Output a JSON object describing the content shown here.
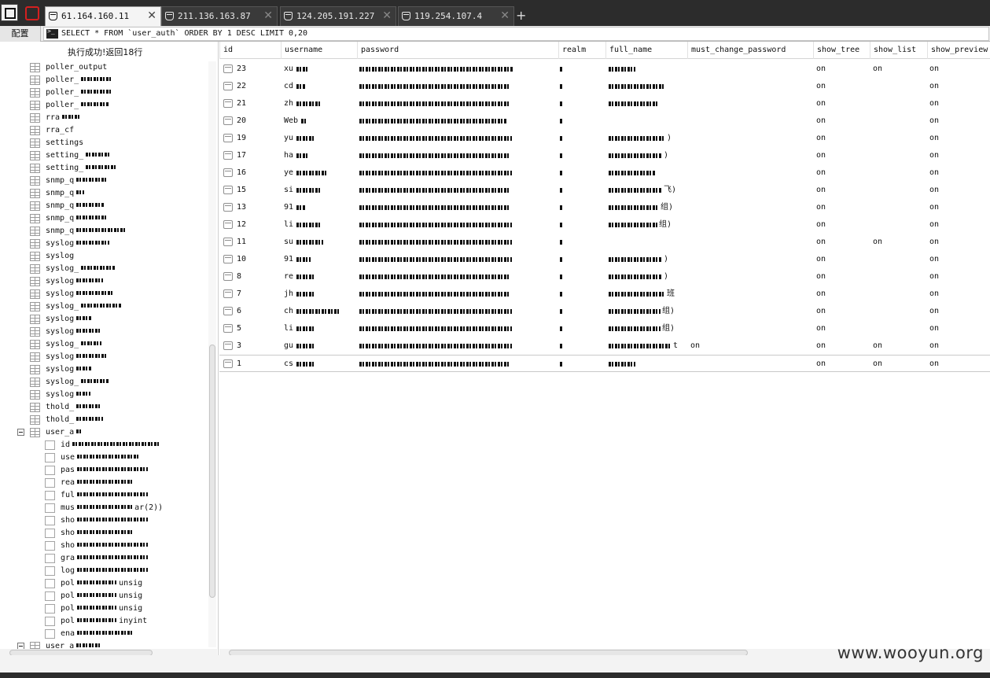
{
  "tabs": [
    {
      "label": "61.164.160.11",
      "active": true
    },
    {
      "label": "211.136.163.87",
      "active": false
    },
    {
      "label": "124.205.191.227",
      "active": false
    },
    {
      "label": "119.254.107.4",
      "active": false
    }
  ],
  "toolbar": {
    "config_label": "配置",
    "sql": "SELECT * FROM `user_auth` ORDER BY 1 DESC LIMIT 0,20"
  },
  "left": {
    "status": "执行成功!返回18行",
    "tables": [
      "poller_output",
      "poller_",
      "poller_",
      "poller_",
      "rra",
      "rra_cf",
      "settings",
      "setting_",
      "setting_",
      "snmp_q",
      "snmp_q",
      "snmp_q",
      "snmp_q",
      "snmp_q",
      "syslog",
      "syslog",
      "syslog_",
      "syslog",
      "syslog",
      "syslog_",
      "syslog",
      "syslog",
      "syslog_",
      "syslog",
      "syslog",
      "syslog_",
      "syslog",
      "thold_",
      "thold_"
    ],
    "expanded_table": "user_a",
    "columns": [
      "id",
      "use",
      "pas",
      "rea",
      "ful",
      "mus",
      "sho",
      "sho",
      "sho",
      "gra",
      "log",
      "pol",
      "pol",
      "pol",
      "pol",
      "ena"
    ],
    "column_tails": {
      "mus": "ar(2))",
      "pol1": "unsig",
      "pol2": "unsig",
      "pol3": "unsig",
      "pol4": "inyint"
    },
    "next_table": "user_a"
  },
  "grid": {
    "headers": [
      "id",
      "username",
      "password",
      "realm",
      "full_name",
      "must_change_password",
      "show_tree",
      "show_list",
      "show_preview"
    ],
    "rows": [
      {
        "id": "23",
        "username": "xu",
        "show_tree": "on",
        "show_list": "on",
        "show_preview": "on",
        "must_change": ""
      },
      {
        "id": "22",
        "username": "cd",
        "show_tree": "on",
        "show_list": "",
        "show_preview": "on",
        "must_change": ""
      },
      {
        "id": "21",
        "username": "zh",
        "show_tree": "on",
        "show_list": "",
        "show_preview": "on",
        "must_change": ""
      },
      {
        "id": "20",
        "username": "Web",
        "show_tree": "on",
        "show_list": "",
        "show_preview": "on",
        "must_change": ""
      },
      {
        "id": "19",
        "username": "yu",
        "show_tree": "on",
        "show_list": "",
        "show_preview": "on",
        "must_change": ""
      },
      {
        "id": "17",
        "username": "ha",
        "show_tree": "on",
        "show_list": "",
        "show_preview": "on",
        "must_change": ""
      },
      {
        "id": "16",
        "username": "ye",
        "show_tree": "on",
        "show_list": "",
        "show_preview": "on",
        "must_change": ""
      },
      {
        "id": "15",
        "username": "si",
        "show_tree": "on",
        "show_list": "",
        "show_preview": "on",
        "must_change": ""
      },
      {
        "id": "13",
        "username": "91",
        "show_tree": "on",
        "show_list": "",
        "show_preview": "on",
        "must_change": ""
      },
      {
        "id": "12",
        "username": "li",
        "show_tree": "on",
        "show_list": "",
        "show_preview": "on",
        "must_change": ""
      },
      {
        "id": "11",
        "username": "su",
        "show_tree": "on",
        "show_list": "on",
        "show_preview": "on",
        "must_change": ""
      },
      {
        "id": "10",
        "username": "91",
        "show_tree": "on",
        "show_list": "",
        "show_preview": "on",
        "must_change": ""
      },
      {
        "id": "8",
        "username": "re",
        "show_tree": "on",
        "show_list": "",
        "show_preview": "on",
        "must_change": ""
      },
      {
        "id": "7",
        "username": "jh",
        "show_tree": "on",
        "show_list": "",
        "show_preview": "on",
        "must_change": ""
      },
      {
        "id": "6",
        "username": "ch",
        "show_tree": "on",
        "show_list": "",
        "show_preview": "on",
        "must_change": ""
      },
      {
        "id": "5",
        "username": "li",
        "show_tree": "on",
        "show_list": "",
        "show_preview": "on",
        "must_change": ""
      },
      {
        "id": "3",
        "username": "gu",
        "show_tree": "on",
        "show_list": "on",
        "show_preview": "on",
        "must_change": "on"
      },
      {
        "id": "1",
        "username": "cs",
        "show_tree": "on",
        "show_list": "on",
        "show_preview": "on",
        "must_change": ""
      }
    ],
    "fullname_tails": [
      "",
      "",
      "",
      "",
      ")",
      ")",
      "",
      "飞)",
      "组)",
      "组)",
      "",
      ")",
      ")",
      "班",
      "组)",
      "组)",
      "t",
      ""
    ]
  },
  "watermark": "www.wooyun.org",
  "colors": {
    "tabbar": "#2c2c2c",
    "active_tab": "#f4f4f4",
    "app_icon_red": "#d42020"
  }
}
